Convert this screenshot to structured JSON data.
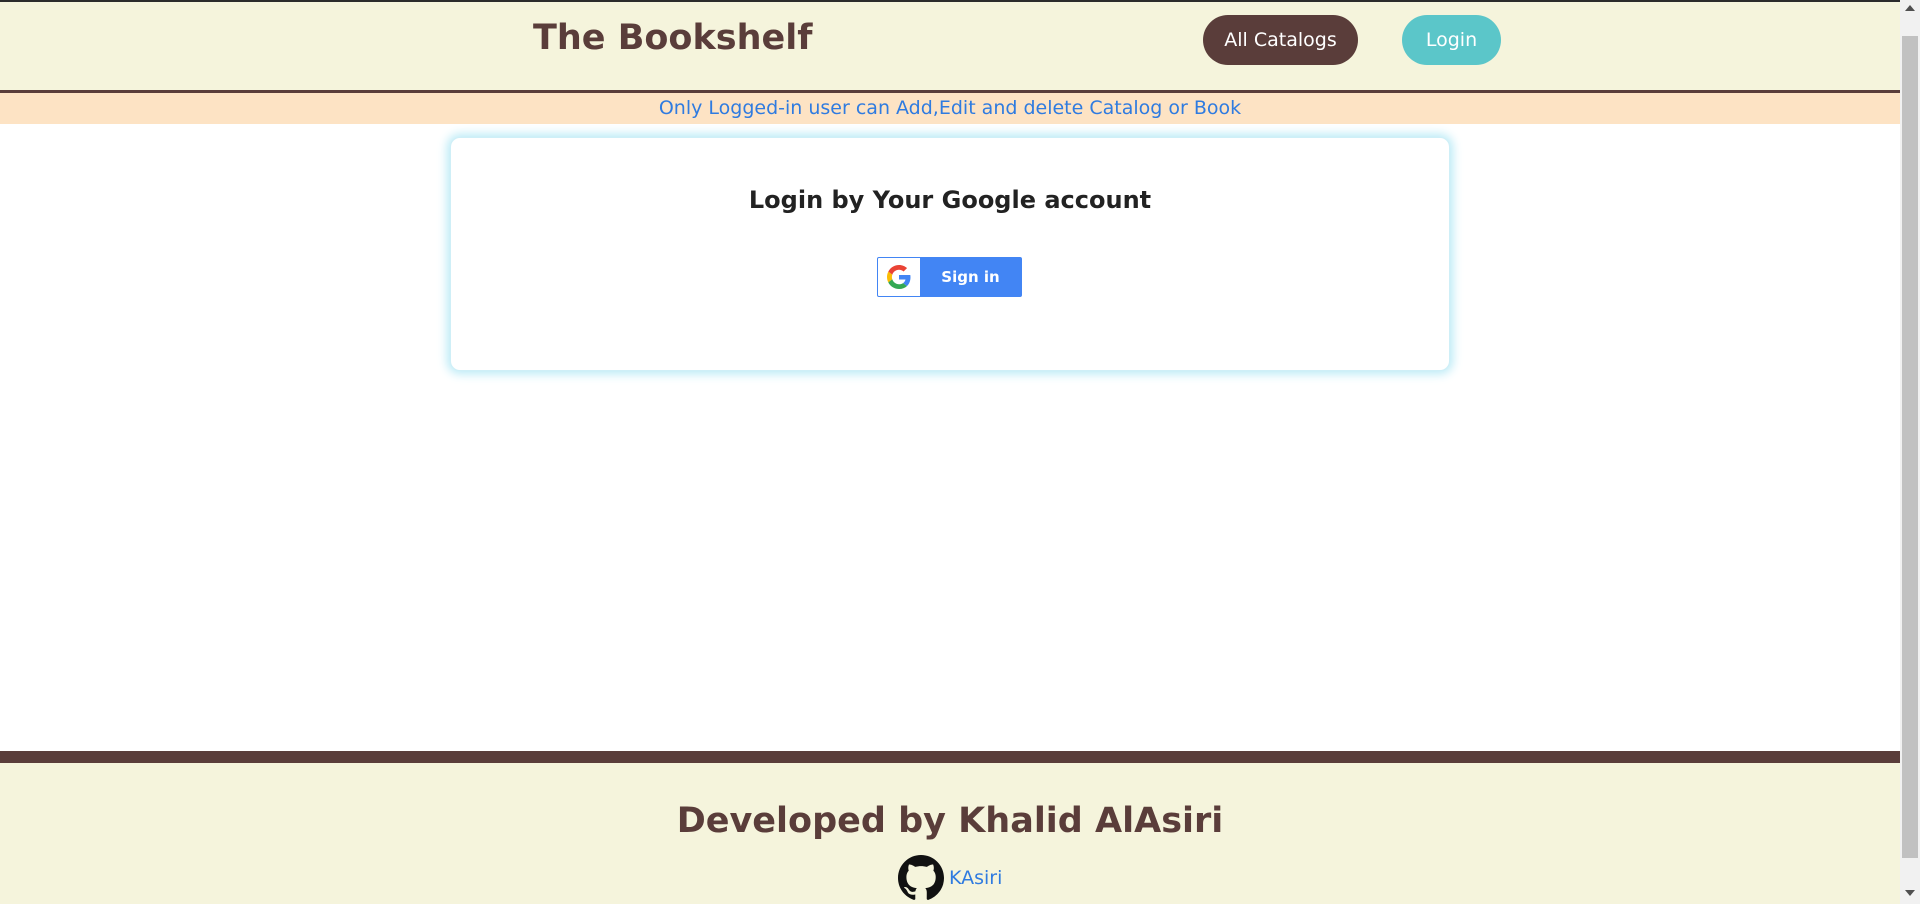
{
  "header": {
    "brand": "The Bookshelf",
    "nav": {
      "all_catalogs": "All Catalogs",
      "login": "Login"
    }
  },
  "notice": "Only Logged-in user can Add,Edit and delete Catalog or Book",
  "login_card": {
    "title": "Login by Your Google account",
    "google_button_label": "Sign in",
    "google_icon": "google-g-icon"
  },
  "footer": {
    "credit": "Developed by Khalid AlAsiri",
    "github_icon": "github-icon",
    "github_username": "KAsiri"
  },
  "colors": {
    "header_bg": "#f5f4dc",
    "brand_brown": "#5a3d3a",
    "login_teal": "#5bc6c9",
    "notice_bg": "#fde3c4",
    "link_blue": "#2f7be0",
    "google_blue": "#4285f4"
  }
}
